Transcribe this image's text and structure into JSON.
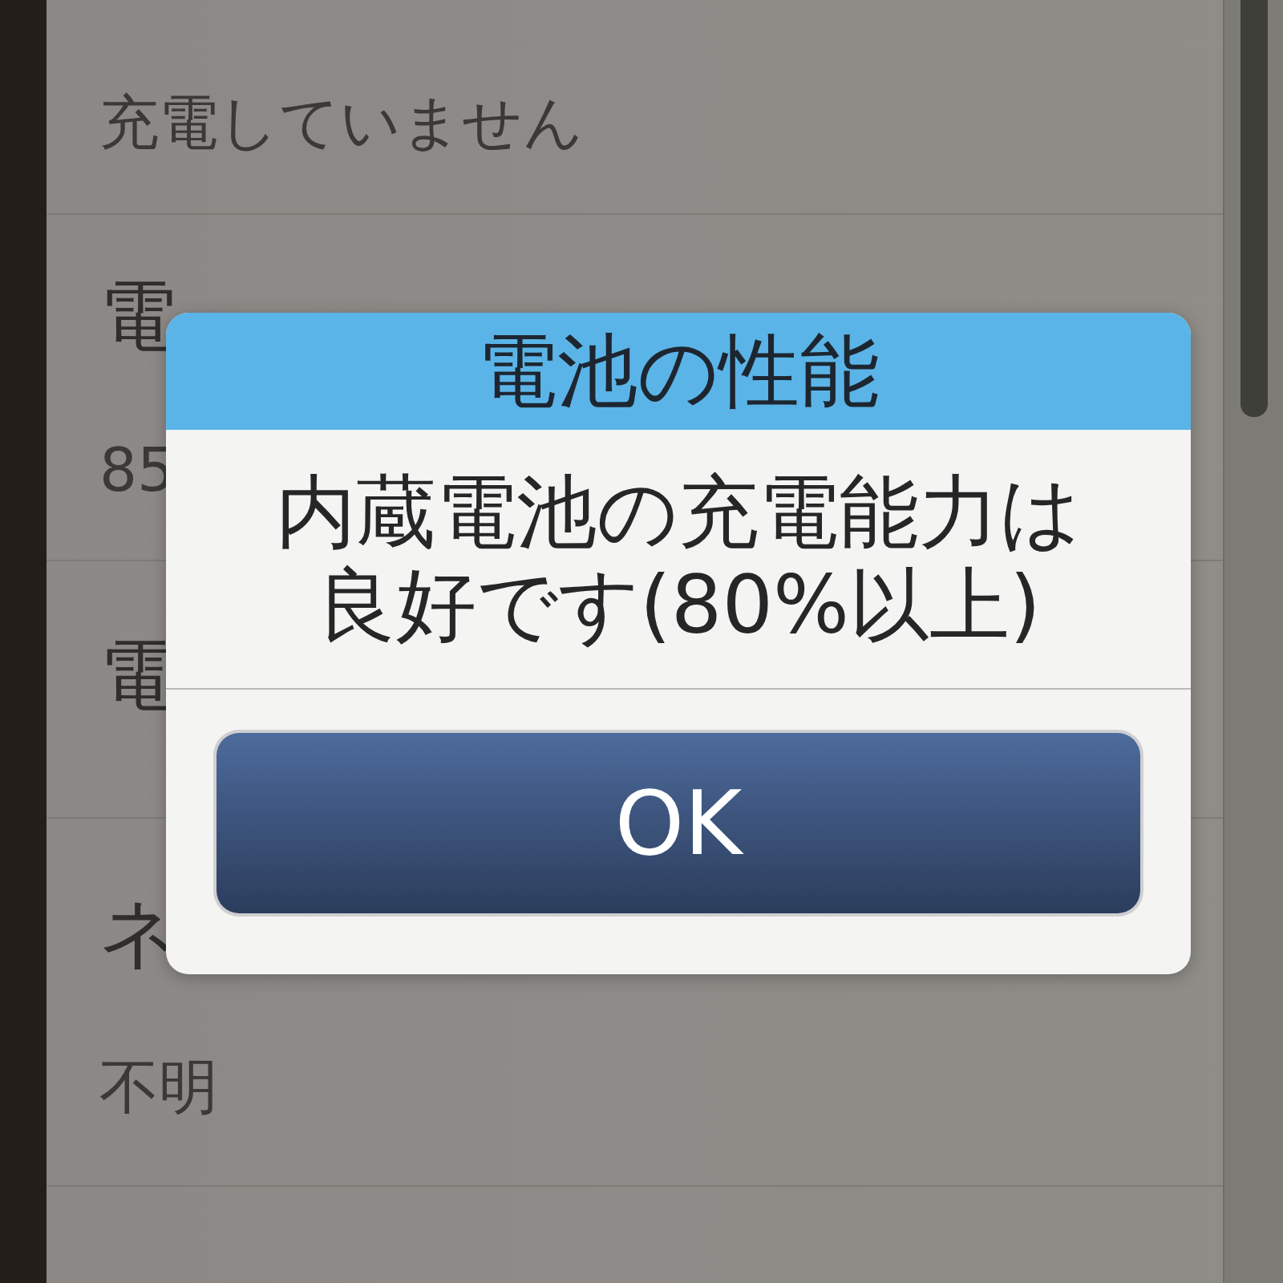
{
  "screen": {
    "rows": [
      {
        "value": "充電していません"
      },
      {
        "heading": "電",
        "value": "85"
      },
      {
        "heading": "電"
      },
      {
        "heading": "ネ",
        "value": "不明"
      }
    ]
  },
  "dialog": {
    "title": "電池の性能",
    "message": "内蔵電池の充電能力は良好です(80%以上)",
    "buttons": [
      {
        "label": "OK"
      }
    ]
  }
}
